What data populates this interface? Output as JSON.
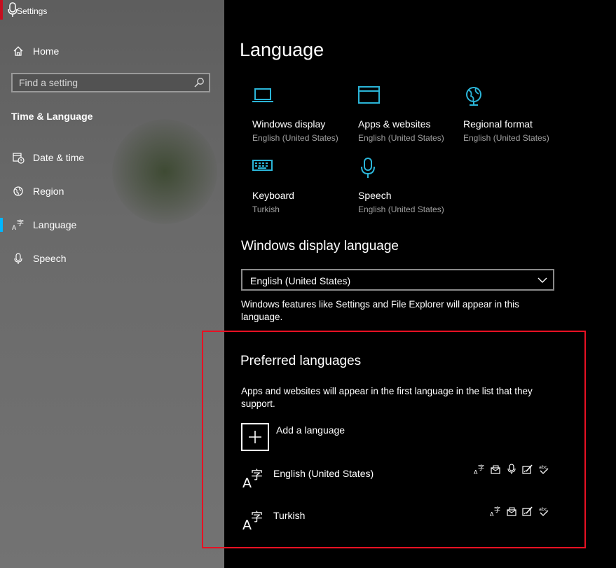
{
  "window": {
    "title": "Settings"
  },
  "sidebar": {
    "home_label": "Home",
    "search_placeholder": "Find a setting",
    "section_title": "Time & Language",
    "items": [
      {
        "label": "Date & time",
        "icon": "calendar-clock-icon"
      },
      {
        "label": "Region",
        "icon": "globe-icon"
      },
      {
        "label": "Language",
        "icon": "language-icon",
        "active": true
      },
      {
        "label": "Speech",
        "icon": "microphone-icon"
      }
    ]
  },
  "main": {
    "title": "Language",
    "tiles": [
      {
        "label": "Windows display",
        "sub": "English (United States)",
        "icon": "laptop-icon"
      },
      {
        "label": "Apps & websites",
        "sub": "English (United States)",
        "icon": "browser-window-icon"
      },
      {
        "label": "Regional format",
        "sub": "English (United States)",
        "icon": "globe-icon"
      },
      {
        "label": "Keyboard",
        "sub": "Turkish",
        "icon": "keyboard-icon"
      },
      {
        "label": "Speech",
        "sub": "English (United States)",
        "icon": "microphone-icon"
      }
    ],
    "display_language": {
      "heading": "Windows display language",
      "selected": "English (United States)",
      "description": "Windows features like Settings and File Explorer will appear in this language."
    },
    "preferred": {
      "heading": "Preferred languages",
      "description": "Apps and websites will appear in the first language in the list that they support.",
      "add_label": "Add a language",
      "languages": [
        {
          "name": "English (United States)",
          "features": [
            "language-pack-icon",
            "text-to-speech-icon",
            "speech-recognition-icon",
            "handwriting-icon",
            "spell-check-icon"
          ]
        },
        {
          "name": "Turkish",
          "features": [
            "language-pack-icon",
            "text-to-speech-icon",
            "handwriting-icon",
            "spell-check-icon"
          ]
        }
      ]
    }
  },
  "colors": {
    "accent": "#00b7ff",
    "tile_icon": "#2bb5d8",
    "highlight_box": "#e81123",
    "sidebar_bg": "#6a6a6a"
  }
}
